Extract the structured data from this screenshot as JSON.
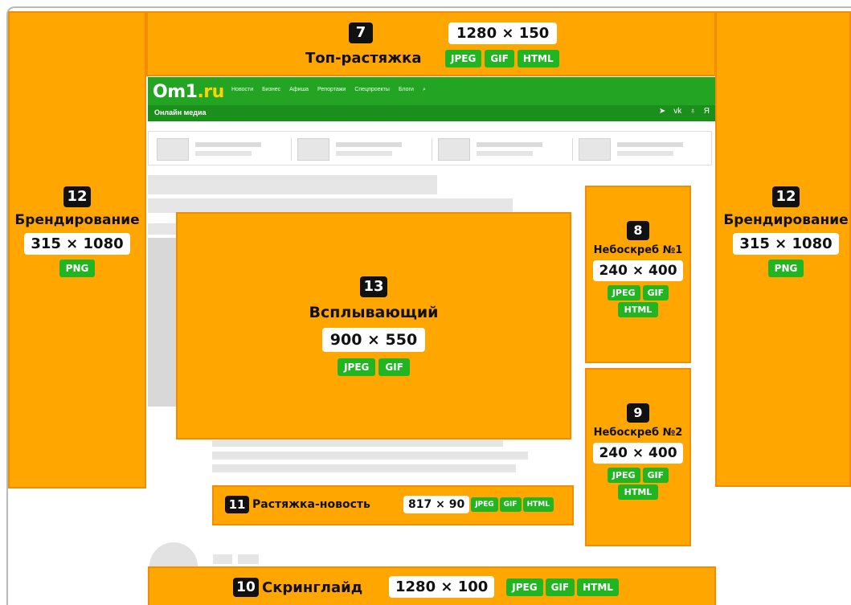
{
  "site": {
    "logo_main": "Om1",
    "logo_tld": ".ru",
    "nav": [
      "Новости",
      "Бизнес",
      "Афиша",
      "Репортажи",
      "Спецпроекты",
      "Блоги"
    ],
    "tagline": "Онлайн медиа",
    "social_icons": [
      "circle-arrow-icon",
      "vk-icon",
      "ok-icon",
      "yandex-icon"
    ]
  },
  "blocks": {
    "top_stretch": {
      "num": "7",
      "title": "Топ-растяжка",
      "size": "1280 × 150",
      "formats": [
        "JPEG",
        "GIF",
        "HTML"
      ]
    },
    "branding_left": {
      "num": "12",
      "title": "Брендирование",
      "size": "315 × 1080",
      "formats": [
        "PNG"
      ]
    },
    "branding_right": {
      "num": "12",
      "title": "Брендирование",
      "size": "315 × 1080",
      "formats": [
        "PNG"
      ]
    },
    "popup": {
      "num": "13",
      "title": "Всплывающий",
      "size": "900 × 550",
      "formats": [
        "JPEG",
        "GIF"
      ]
    },
    "skyscraper1": {
      "num": "8",
      "title": "Небоскреб №1",
      "size": "240 × 400",
      "formats": [
        "JPEG",
        "GIF",
        "HTML"
      ]
    },
    "skyscraper2": {
      "num": "9",
      "title": "Небоскреб №2",
      "size": "240 × 400",
      "formats": [
        "JPEG",
        "GIF",
        "HTML"
      ]
    },
    "news_stretch": {
      "num": "11",
      "title": "Растяжка-новость",
      "size": "817 × 90",
      "formats": [
        "JPEG",
        "GIF",
        "HTML"
      ]
    },
    "screenglide": {
      "num": "10",
      "title": "Скринглайд",
      "size": "1280 × 100",
      "formats": [
        "JPEG",
        "GIF",
        "HTML"
      ]
    }
  },
  "colors": {
    "ad_orange": "#ffa600",
    "format_green": "#22b522",
    "site_green": "#23a523",
    "logo_yellow": "#ffd200"
  }
}
